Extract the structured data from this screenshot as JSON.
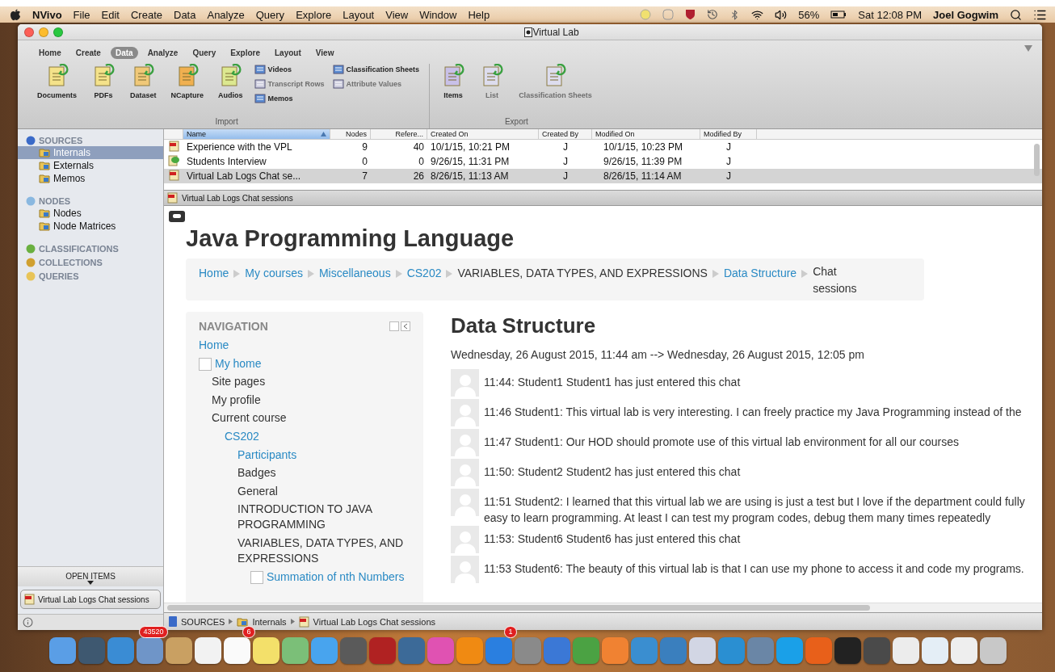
{
  "menubar": {
    "app_name": "NVivo",
    "menus": [
      "File",
      "Edit",
      "Create",
      "Data",
      "Analyze",
      "Query",
      "Explore",
      "Layout",
      "View",
      "Window",
      "Help"
    ],
    "battery": "56%",
    "clock": "Sat 12:08 PM",
    "user": "Joel Gogwim"
  },
  "window": {
    "title": "Virtual Lab"
  },
  "ribbon": {
    "tabs": [
      {
        "label": "Home",
        "selected": false
      },
      {
        "label": "Create",
        "selected": false
      },
      {
        "label": "Data",
        "selected": true
      },
      {
        "label": "Analyze",
        "selected": false
      },
      {
        "label": "Query",
        "selected": false
      },
      {
        "label": "Explore",
        "selected": false
      },
      {
        "label": "Layout",
        "selected": false
      },
      {
        "label": "View",
        "selected": false
      }
    ],
    "groups": [
      {
        "label": "Import",
        "items": [
          {
            "kind": "large",
            "label": "Documents",
            "disabled": false
          },
          {
            "kind": "large",
            "label": "PDFs",
            "disabled": false
          },
          {
            "kind": "large",
            "label": "Dataset",
            "disabled": false
          },
          {
            "kind": "large",
            "label": "NCapture",
            "disabled": false
          },
          {
            "kind": "large",
            "label": "Audios",
            "disabled": false
          },
          {
            "kind": "stack",
            "items": [
              {
                "label": "Videos",
                "disabled": false
              },
              {
                "label": "Transcript Rows",
                "disabled": true
              },
              {
                "label": "Memos",
                "disabled": false
              }
            ]
          },
          {
            "kind": "stack",
            "items": [
              {
                "label": "Classification Sheets",
                "disabled": false
              },
              {
                "label": "Attribute Values",
                "disabled": true
              }
            ]
          }
        ]
      },
      {
        "label": "Export",
        "items": [
          {
            "kind": "large",
            "label": "Items",
            "disabled": false
          },
          {
            "kind": "large",
            "label": "List",
            "disabled": true
          },
          {
            "kind": "large",
            "label": "Classification Sheets",
            "disabled": true
          }
        ]
      }
    ]
  },
  "sidebar": {
    "sections": [
      {
        "label": "SOURCES",
        "items": [
          {
            "label": "Internals",
            "selected": true
          },
          {
            "label": "Externals",
            "selected": false
          },
          {
            "label": "Memos",
            "selected": false
          }
        ]
      },
      {
        "label": "NODES",
        "items": [
          {
            "label": "Nodes",
            "selected": false
          },
          {
            "label": "Node Matrices",
            "selected": false
          }
        ]
      },
      {
        "label": "CLASSIFICATIONS"
      },
      {
        "label": "COLLECTIONS"
      },
      {
        "label": "QUERIES"
      }
    ],
    "open_items": {
      "label": "OPEN ITEMS",
      "items": [
        "Virtual Lab Logs Chat sessions"
      ]
    }
  },
  "table": {
    "columns": [
      "Name",
      "Nodes",
      "Refere...",
      "Created On",
      "Created By",
      "Modified On",
      "Modified By"
    ],
    "rows": [
      {
        "kind": "pdf",
        "selected": false,
        "cells": [
          "Experience with the VPL",
          "9",
          "40",
          "10/1/15, 10:21 PM",
          "J",
          "10/1/15, 10:23 PM",
          "J"
        ]
      },
      {
        "kind": "interview",
        "selected": false,
        "cells": [
          "Students Interview",
          "0",
          "0",
          "9/26/15, 11:31 PM",
          "J",
          "9/26/15, 11:39 PM",
          "J"
        ]
      },
      {
        "kind": "pdf",
        "selected": true,
        "cells": [
          "Virtual Lab Logs Chat se...",
          "7",
          "26",
          "8/26/15, 11:13 AM",
          "J",
          "8/26/15, 11:14 AM",
          "J"
        ]
      }
    ]
  },
  "viewer": {
    "title": "Virtual Lab Logs Chat sessions",
    "page": {
      "course_title": "Java Programming Language",
      "breadcrumb": [
        {
          "label": "Home",
          "kind": "link"
        },
        {
          "label": "My courses",
          "kind": "link"
        },
        {
          "label": "Miscellaneous",
          "kind": "link"
        },
        {
          "label": "CS202",
          "kind": "link"
        },
        {
          "label": "VARIABLES, DATA TYPES, AND EXPRESSIONS",
          "kind": "text"
        },
        {
          "label": "Data Structure",
          "kind": "link"
        },
        {
          "label": "Chat sessions",
          "kind": "text"
        }
      ],
      "navigation": {
        "title": "NAVIGATION",
        "items": [
          {
            "label": "Home",
            "kind": "link"
          },
          {
            "label": "My home",
            "kind": "activity",
            "children": [
              {
                "label": "Site pages",
                "kind": "text"
              },
              {
                "label": "My profile",
                "kind": "text"
              },
              {
                "label": "Current course",
                "kind": "text",
                "children": [
                  {
                    "label": "CS202",
                    "kind": "link",
                    "children": [
                      {
                        "label": "Participants",
                        "kind": "link"
                      },
                      {
                        "label": "Badges",
                        "kind": "text"
                      },
                      {
                        "label": "General",
                        "kind": "text"
                      },
                      {
                        "label": "INTRODUCTION TO JAVA PROGRAMMING",
                        "kind": "text"
                      },
                      {
                        "label": "VARIABLES, DATA TYPES, AND EXPRESSIONS",
                        "kind": "text",
                        "children": [
                          {
                            "label": "Summation of nth Numbers",
                            "kind": "activity"
                          }
                        ]
                      }
                    ]
                  }
                ]
              }
            ]
          }
        ]
      },
      "chat": {
        "title": "Data Structure",
        "period": "Wednesday, 26 August 2015, 11:44 am --> Wednesday, 26 August 2015, 12:05 pm",
        "messages": [
          {
            "lines": [
              "11:44: Student1 Student1 has just entered this chat"
            ]
          },
          {
            "lines": [
              "11:46 Student1: This virtual lab is very interesting. I can freely practice my Java Programming instead of the"
            ]
          },
          {
            "lines": [
              "11:47 Student1: Our HOD should promote use of this virtual lab environment for all our courses"
            ]
          },
          {
            "lines": [
              "11:50: Student2 Student2 has just entered this chat"
            ]
          },
          {
            "lines": [
              "11:51 Student2: I learned that this virtual lab we are using is just a test but I love if the department could fully",
              "easy to learn programming. At least I can test my program codes, debug them many times repeatedly"
            ]
          },
          {
            "lines": [
              "11:53: Student6 Student6 has just entered this chat"
            ]
          },
          {
            "lines": [
              "11:53 Student6: The beauty of this virtual lab is that I can use my phone to access it and code my programs."
            ]
          }
        ]
      }
    }
  },
  "status_bar": {
    "path": [
      "SOURCES",
      "Internals",
      "Virtual Lab Logs Chat sessions"
    ]
  },
  "dock": {
    "items": [
      {
        "color": "#5a9ee6"
      },
      {
        "color": "#3e5870"
      },
      {
        "color": "#3a8cd4"
      },
      {
        "color": "#6f95c8",
        "badge": "43520"
      },
      {
        "color": "#c9a062"
      },
      {
        "color": "#f2f2f2"
      },
      {
        "color": "#fafafa",
        "badge": "6"
      },
      {
        "color": "#f3e06a"
      },
      {
        "color": "#7bbf78"
      },
      {
        "color": "#48a4ee"
      },
      {
        "color": "#5a5a5a"
      },
      {
        "color": "#b02222"
      },
      {
        "color": "#3c6a98"
      },
      {
        "color": "#e052b2"
      },
      {
        "color": "#f08a12"
      },
      {
        "color": "#2a7fe0",
        "badge": "1"
      },
      {
        "color": "#8a8a8a"
      },
      {
        "color": "#3b78d6"
      },
      {
        "color": "#4ba243"
      },
      {
        "color": "#f08232"
      },
      {
        "color": "#3a8ed0"
      },
      {
        "color": "#3a7fbe"
      },
      {
        "color": "#d2d6e4"
      },
      {
        "color": "#2a8fd2"
      },
      {
        "color": "#6a86a6"
      },
      {
        "color": "#1aa0e8"
      },
      {
        "color": "#e8601a"
      },
      {
        "color": "#222222"
      },
      {
        "color": "#4a4a4a"
      },
      {
        "color": "#ececec"
      },
      {
        "color": "#e4eef6"
      },
      {
        "color": "#eeeeee"
      },
      {
        "color": "#c8c8c8"
      }
    ]
  }
}
